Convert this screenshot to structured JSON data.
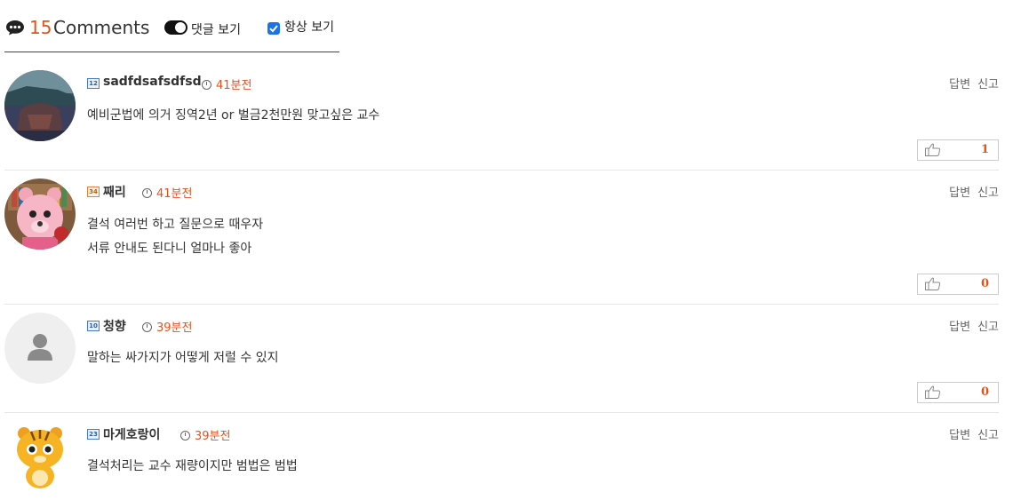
{
  "header": {
    "count": "15",
    "label": "Comments",
    "toggle_label": "댓글 보기",
    "checkbox_label": "항상 보기"
  },
  "actions": {
    "reply": "답변",
    "report": "신고"
  },
  "comments": [
    {
      "level": "12",
      "username": "sadfdsafsdfsd",
      "time": "41분전",
      "lines": [
        "예비군법에 의거 징역2년 or 벌금2천만원 맞고싶은 교수"
      ],
      "likes": "1"
    },
    {
      "level": "34",
      "username": "째리",
      "time": "41분전",
      "lines": [
        "결석 여러번 하고 질문으로 때우자",
        "서류 안내도 된다니 얼마나 좋아"
      ],
      "likes": "0"
    },
    {
      "level": "10",
      "username": "청향",
      "time": "39분전",
      "lines": [
        "말하는 싸가지가 어떻게 저럴 수 있지"
      ],
      "likes": "0"
    },
    {
      "level": "23",
      "username": "마게호랑이",
      "time": "39분전",
      "lines": [
        "결석처리는 교수 재량이지만 범법은 범법"
      ]
    }
  ]
}
